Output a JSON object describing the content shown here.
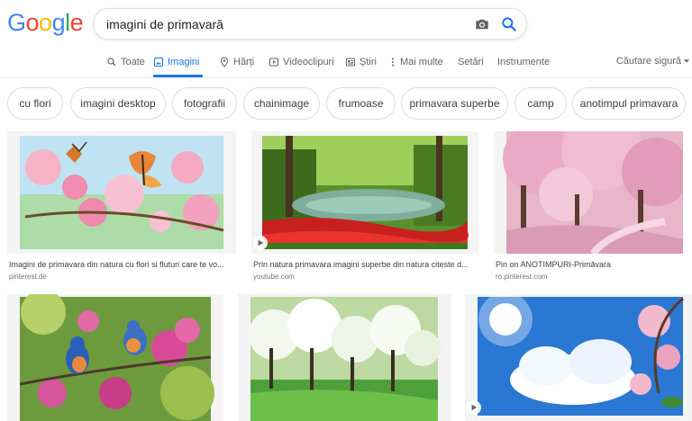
{
  "logo": [
    "G",
    "o",
    "o",
    "g",
    "l",
    "e"
  ],
  "logo_colors": [
    "#4285f4",
    "#ea4335",
    "#fbbc05",
    "#4285f4",
    "#34a853",
    "#ea4335"
  ],
  "search": {
    "value": "imagini de primavară"
  },
  "tabs": [
    {
      "label": "Toate",
      "icon": "search-icon"
    },
    {
      "label": "Imagini",
      "icon": "image-icon",
      "active": true
    },
    {
      "label": "Hărți",
      "icon": "map-pin-icon"
    },
    {
      "label": "Videoclipuri",
      "icon": "play-icon"
    },
    {
      "label": "Știri",
      "icon": "news-icon"
    },
    {
      "label": "Mai multe",
      "icon": "more-vert-icon"
    },
    {
      "label": "Setări"
    },
    {
      "label": "Instrumente"
    }
  ],
  "safe_search": "Căutare sigură",
  "chips": [
    "cu flori",
    "imagini desktop",
    "fotografii",
    "chainimage",
    "frumoase",
    "primavara superbe",
    "camp",
    "anotimpul primavara"
  ],
  "results": [
    {
      "caption": "Imagini de primavara din natura cu flori si fluturi care te vo...",
      "source": "pinterest.de"
    },
    {
      "caption": "Prin natura primavara imagini superbe din natura citeste d...",
      "source": "youtube.com"
    },
    {
      "caption": "Pin on ANOTIMPURI-Primăvara",
      "source": "ro.pinterest.com"
    },
    {
      "caption": "",
      "source": ""
    },
    {
      "caption": "",
      "source": ""
    },
    {
      "caption": "",
      "source": ""
    }
  ],
  "colors": {
    "accent": "#1a73e8",
    "text": "#202124",
    "muted": "#5f6368",
    "border": "#dadce0"
  }
}
